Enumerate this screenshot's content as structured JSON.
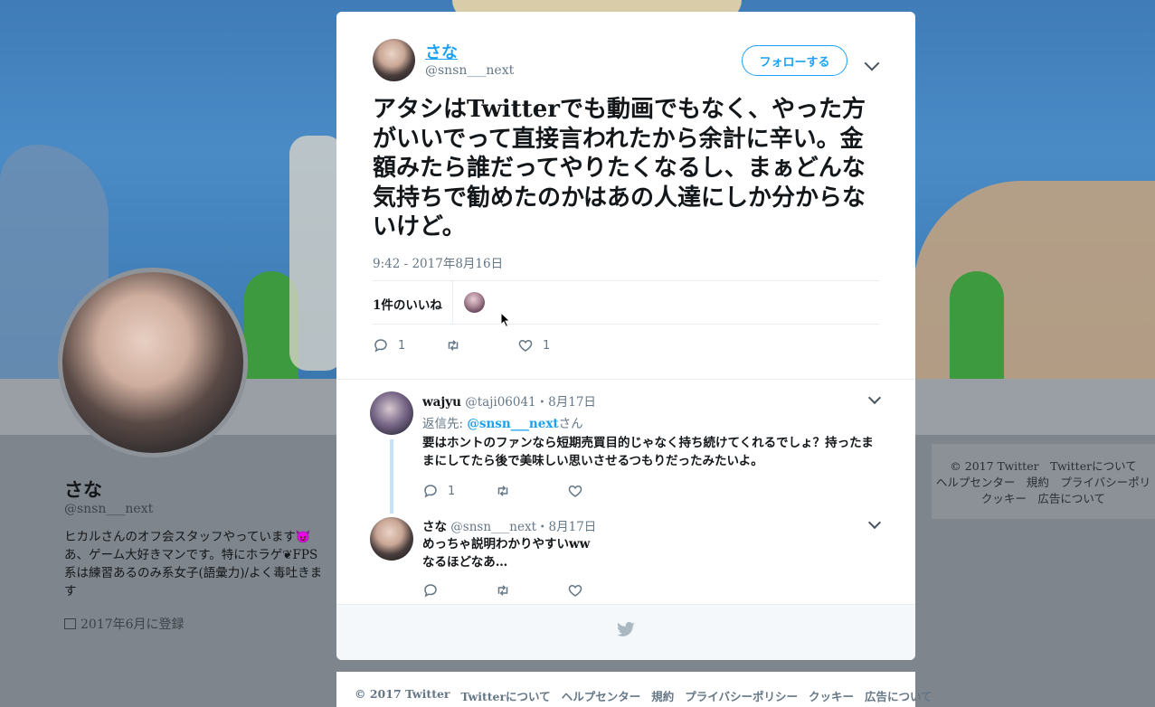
{
  "background_profile": {
    "name": "さな",
    "handle": "@snsn___next",
    "bio": "ヒカルさんのオフ会スタッフやっています😈あ、ゲーム大好きマンです。特にホラゲ❦FPS系は練習あるのみ系女子(語彙力)/よく毒吐きます",
    "joined": "2017年6月に登録",
    "side_footer": {
      "line1": "© 2017 Twitter　Twitterについて",
      "line2": "ヘルプセンター　規約　プライバシーポリ",
      "line3": "クッキー　広告について"
    }
  },
  "tweet": {
    "author_name": "さな",
    "author_handle": "@snsn___next",
    "follow_label": "フォローする",
    "text": "アタシはTwitterでも動画でもなく、やった方がいいでって直接言われたから余計に辛い。金額みたら誰だってやりたくなるし、まぁどんな気持ちで勧めたのかはあの人達にしか分からないけど。",
    "timestamp": "9:42 - 2017年8月16日",
    "likes_count": "1件のいいね",
    "reply_count": "1",
    "like_count": "1"
  },
  "replies": [
    {
      "name": "wajyu",
      "handle_date": "@taji06041・8月17日",
      "reply_to_prefix": "返信先: ",
      "reply_to_handle": "@snsn___next",
      "reply_to_suffix": "さん",
      "text": "要はホントのファンなら短期売買目的じゃなく持ち続けてくれるでしょ？持ったままにしてたら後で美味しい思いさせるつもりだったみたいよ。",
      "reply_count": "1"
    },
    {
      "name": "さな",
      "handle_date": "@snsn___next・8月17日",
      "text_line1": "めっちゃ説明わかりやすいww",
      "text_line2": "なるほどなあ…"
    }
  ],
  "footer": {
    "copyright": "© 2017 Twitter",
    "about": "Twitterについて",
    "help": "ヘルプセンター",
    "terms": "規約",
    "privacy": "プライバシーポリシー",
    "cookies": "クッキー",
    "ads": "広告について"
  },
  "colors": {
    "accent": "#1da1f2",
    "secondary_text": "#657786",
    "thread_line": "#c4e3f6"
  },
  "icons": [
    "reply-icon",
    "retweet-icon",
    "heart-icon",
    "chevron-down-icon",
    "twitter-bird-icon",
    "calendar-icon"
  ]
}
